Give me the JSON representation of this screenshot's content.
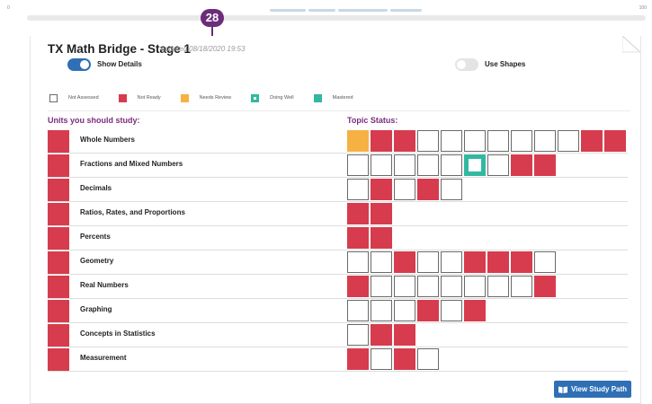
{
  "progress": {
    "left_value": "0",
    "right_value": "100",
    "current": "28"
  },
  "header": {
    "title": "TX Math Bridge - Stage 1",
    "updated": "updated 08/18/2020 19:53"
  },
  "toggles": {
    "show_details": {
      "label": "Show Details",
      "on": true
    },
    "use_shapes": {
      "label": "Use Shapes",
      "on": false
    }
  },
  "legend": [
    {
      "key": "not_assessed",
      "label": "Not Assessed",
      "color": "#ffffff"
    },
    {
      "key": "not_ready",
      "label": "Not Ready",
      "color": "#d63c4d"
    },
    {
      "key": "needs_review",
      "label": "Needs Review",
      "color": "#f5b242"
    },
    {
      "key": "doing_well",
      "label": "Doing Well",
      "color": "#33b8a0"
    },
    {
      "key": "mastered",
      "label": "Mastered",
      "color": "#33b8a0"
    }
  ],
  "columns": {
    "units": "Units you should study:",
    "topics": "Topic Status:"
  },
  "units": [
    {
      "name": "Whole Numbers",
      "topics": [
        "needs_review",
        "not_ready",
        "not_ready",
        "not_assessed",
        "not_assessed",
        "not_assessed",
        "not_assessed",
        "not_assessed",
        "not_assessed",
        "not_assessed",
        "not_ready",
        "not_ready"
      ]
    },
    {
      "name": "Fractions and Mixed Numbers",
      "topics": [
        "not_assessed",
        "not_assessed",
        "not_assessed",
        "not_assessed",
        "not_assessed",
        "doing_well",
        "not_assessed",
        "not_ready",
        "not_ready"
      ]
    },
    {
      "name": "Decimals",
      "topics": [
        "not_assessed",
        "not_ready",
        "not_assessed",
        "not_ready",
        "not_assessed"
      ]
    },
    {
      "name": "Ratios, Rates, and Proportions",
      "topics": [
        "not_ready",
        "not_ready"
      ]
    },
    {
      "name": "Percents",
      "topics": [
        "not_ready",
        "not_ready"
      ]
    },
    {
      "name": "Geometry",
      "topics": [
        "not_assessed",
        "not_assessed",
        "not_ready",
        "not_assessed",
        "not_assessed",
        "not_ready",
        "not_ready",
        "not_ready",
        "not_assessed"
      ]
    },
    {
      "name": "Real Numbers",
      "topics": [
        "not_ready",
        "not_assessed",
        "not_assessed",
        "not_assessed",
        "not_assessed",
        "not_assessed",
        "not_assessed",
        "not_assessed",
        "not_ready"
      ]
    },
    {
      "name": "Graphing",
      "topics": [
        "not_assessed",
        "not_assessed",
        "not_assessed",
        "not_ready",
        "not_assessed",
        "not_ready"
      ]
    },
    {
      "name": "Concepts in Statistics",
      "topics": [
        "not_assessed",
        "not_ready",
        "not_ready"
      ]
    },
    {
      "name": "Measurement",
      "topics": [
        "not_ready",
        "not_assessed",
        "not_ready",
        "not_assessed"
      ]
    }
  ],
  "actions": {
    "view_study_path": "View Study Path",
    "icon": "book-icon"
  },
  "colors": {
    "accent": "#2f6fb5",
    "marker": "#6b2d7a",
    "heading": "#7a2c7e",
    "not_ready": "#d63c4d"
  }
}
